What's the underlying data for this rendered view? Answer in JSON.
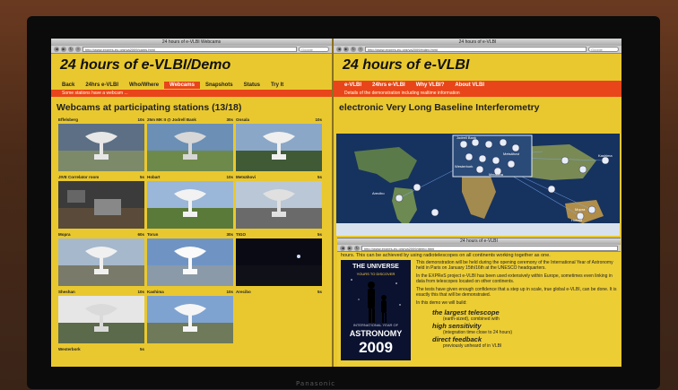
{
  "tv": {
    "brand": "Panasonic"
  },
  "left_window": {
    "title": "24 hours of e-VLBI Webcams",
    "url": "http://www.expres-eu.org/ya2009/cams.html",
    "search_placeholder": "Google",
    "banner": "24 hours of e-VLBI/Demo",
    "nav": [
      "Back",
      "24hrs e-VLBI",
      "Who/Where",
      "Webcams",
      "Snapshots",
      "Status",
      "Try It"
    ],
    "active_tab": "Webcams",
    "subtitle": "Some stations have a webcam ...",
    "heading": "Webcams at participating stations (13/18)",
    "cams": [
      {
        "name": "Effelsberg",
        "interval": "10s"
      },
      {
        "name": "25m MK II @ Jodrell Bank",
        "interval": "30s"
      },
      {
        "name": "Onsala",
        "interval": "10s"
      },
      {
        "name": "JIVE Correlator room",
        "interval": "5s"
      },
      {
        "name": "Hobart",
        "interval": "10s"
      },
      {
        "name": "Metsähovi",
        "interval": "5s"
      },
      {
        "name": "Mopra",
        "interval": "60s"
      },
      {
        "name": "Torun",
        "interval": "30s"
      },
      {
        "name": "TIGO",
        "interval": "5s"
      },
      {
        "name": "Sheshan",
        "interval": "10s"
      },
      {
        "name": "Kashima",
        "interval": "10s"
      },
      {
        "name": "Arecibo",
        "interval": "5s"
      },
      {
        "name": "Westerbork",
        "interval": "5s"
      }
    ]
  },
  "right_window": {
    "title": "24 hours of e-VLBI",
    "url": "http://www.expres-eu.org/ya2009/index.html",
    "search_placeholder": "Google",
    "banner": "24 hours of e-VLBI",
    "nav": [
      "e-VLBI",
      "24hrs e-VLBI",
      "Why VLBI?",
      "About VLBI"
    ],
    "subtitle": "Details of the demonstration including realtime information",
    "heading": "electronic Very Long Baseline Interferometry",
    "map_labels": [
      "Jodrell Bank",
      "Westerbork",
      "Metsähovi",
      "Medicina",
      "Hobart",
      "Arecibo",
      "Mopra",
      "Kashima"
    ]
  },
  "popup": {
    "title": "24 hours of e-VLBI",
    "url": "http://www.expres-eu.org/ya2009/demo.html",
    "top_line": "hours. This can be achieved by using radiotelescopes on all continents working together as one.",
    "poster": {
      "title": "THE UNIVERSE",
      "subtitle": "YOURS TO DISCOVER",
      "iya": "INTERNATIONAL YEAR OF",
      "astronomy": "ASTRONOMY",
      "year": "2009"
    },
    "paragraphs": [
      "This demonstration will be held during the opening ceremony of the International Year of Astronomy held in Paris on January 15th/16th at the UNESCO headquarters.",
      "In the EXPReS project e-VLBI has been used extensively within Europe, sometimes even linking in data from telescopes located on other continents.",
      "The tests have given enough confidence that a step up in scale, true global e-VLBI, can be done. It is exactly this that will be demonstrated.",
      "In this demo we will build:"
    ],
    "features": [
      {
        "big": "the largest telescope",
        "small": "(earth-sized), combined with"
      },
      {
        "big": "high sensitivity",
        "small": "(integration time close to 24 hours)"
      },
      {
        "big": "direct feedback",
        "small": "previously unheard of in VLBI"
      }
    ]
  }
}
